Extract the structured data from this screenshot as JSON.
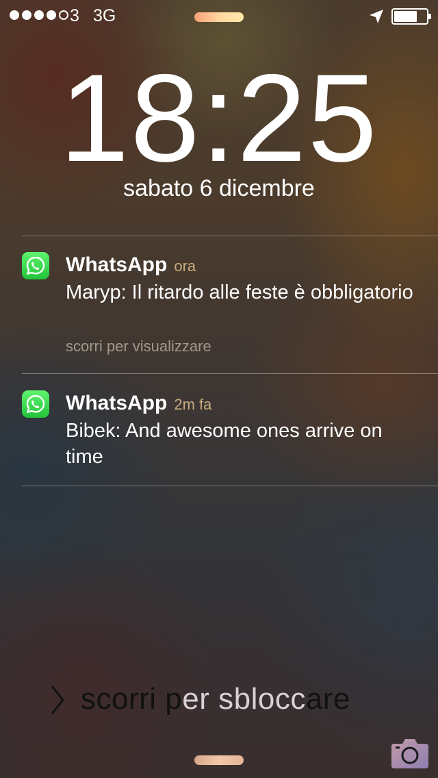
{
  "status_bar": {
    "signal_bars": [
      true,
      true,
      true,
      true,
      false
    ],
    "carrier": "3",
    "network": "3G",
    "battery_level": 0.66,
    "icons": [
      "location-arrow-icon",
      "battery-icon"
    ]
  },
  "lockscreen": {
    "time": "18:25",
    "date": "sabato 6 dicembre"
  },
  "notifications": [
    {
      "app": "WhatsApp",
      "time": "ora",
      "message": "Maryp: Il ritardo alle feste è obbligatorio",
      "hint": "scorri per visualizzare",
      "icon": "whatsapp-icon"
    },
    {
      "app": "WhatsApp",
      "time": "2m fa",
      "message": "Bibek: And awesome ones arrive on time",
      "icon": "whatsapp-icon"
    }
  ],
  "unlock": {
    "text_part1": "scorri p",
    "text_part2": "er sblocc",
    "text_part3": "are"
  },
  "colors": {
    "whatsapp_green": "#2fd24a",
    "notification_time": "#e1be8c"
  }
}
